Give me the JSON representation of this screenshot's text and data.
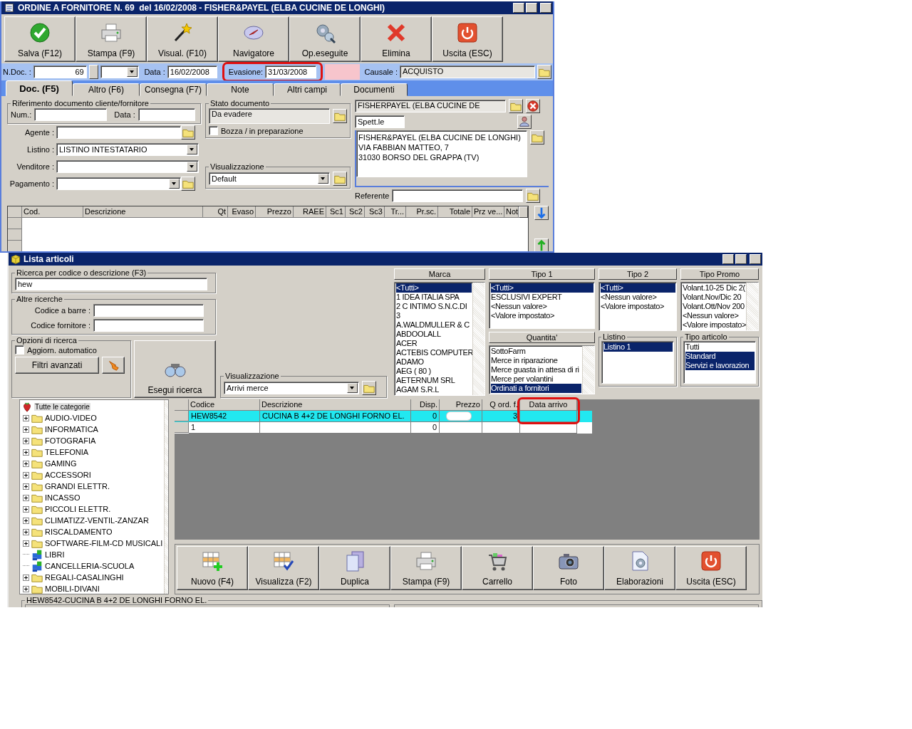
{
  "order_window": {
    "title": "ORDINE A FORNITORE N. 69  del 16/02/2008 - FISHER&PAYEL (ELBA CUCINE DE LONGHI)",
    "toolbar": [
      "Salva (F12)",
      "Stampa (F9)",
      "Visual. (F10)",
      "Navigatore",
      "Op.eseguite",
      "Elimina",
      "Uscita (ESC)"
    ],
    "header": {
      "ndoc_label": "N.Doc. :",
      "ndoc": "69",
      "data_label": "Data :",
      "data": "16/02/2008",
      "evasione_label": "Evasione:",
      "evasione": "31/03/2008",
      "evasione_highlighted": true,
      "causale_label": "Causale :",
      "causale": "ACQUISTO"
    },
    "tabs": [
      {
        "label": "Doc. (F5)",
        "selected": true
      },
      {
        "label": "Altro (F6)",
        "selected": false
      },
      {
        "label": "Consegna (F7)",
        "selected": false
      },
      {
        "label": "Note",
        "selected": false
      },
      {
        "label": "Altri campi",
        "selected": false
      },
      {
        "label": "Documenti",
        "selected": false
      }
    ],
    "riferimento": {
      "legend": "Riferimento documento cliente/fornitore",
      "num_label": "Num.:",
      "data_label": "Data :"
    },
    "left_fields": [
      {
        "label": "Agente :",
        "kind": "text"
      },
      {
        "label": "Listino :",
        "kind": "dropdown",
        "value": "LISTINO INTESTATARIO"
      },
      {
        "label": "Venditore :",
        "kind": "dropdown"
      },
      {
        "label": "Pagamento :",
        "kind": "dropdown_folder"
      }
    ],
    "stato": {
      "legend": "Stato documento",
      "value": "Da evadere",
      "bozza_label": "Bozza / in preparazione",
      "bozza_checked": false
    },
    "visualizzazione": {
      "legend": "Visualizzazione",
      "value": "Default"
    },
    "supplier": {
      "name": "FISHERPAYEL (ELBA CUCINE DE",
      "salutation": "Spett.le",
      "address": [
        "FISHER&PAYEL (ELBA CUCINE DE LONGHI)",
        "VIA FABBIAN MATTEO, 7",
        "31030 BORSO DEL GRAPPA (TV)"
      ],
      "referente_label": "Referente"
    },
    "grid": {
      "columns": [
        "Cod.",
        "Descrizione",
        "Qt",
        "Evaso",
        "Prezzo",
        "RAEE",
        "Sc1",
        "Sc2",
        "Sc3",
        "Tr...",
        "Pr.sc.",
        "Totale",
        "Prz ve...",
        "Not"
      ]
    }
  },
  "articles_window": {
    "title": "Lista articoli",
    "search": {
      "legend": "Ricerca per codice o descrizione (F3)",
      "value": "hew"
    },
    "altre": {
      "legend": "Altre ricerche",
      "barcode_label": "Codice a barre :",
      "supplier_code_label": "Codice fornitore :"
    },
    "opzioni": {
      "legend": "Opzioni di ricerca",
      "auto_label": "Aggiorn. automatico",
      "auto_checked": false,
      "filters_button": "Filtri avanzati"
    },
    "run_button": "Esegui ricerca",
    "visualizzazione": {
      "legend": "Visualizzazione",
      "value": "Arrivi merce"
    },
    "marca": {
      "header": "Marca",
      "items": [
        {
          "label": "<Tutti>",
          "selected": true
        },
        {
          "label": "1 IDEA ITALIA SPA",
          "selected": false
        },
        {
          "label": "2 C INTIMO S.N.C.DI",
          "selected": false
        },
        {
          "label": "3",
          "selected": false
        },
        {
          "label": "A.WALDMULLER & C",
          "selected": false
        },
        {
          "label": "ABDOOLALL",
          "selected": false
        },
        {
          "label": "ACER",
          "selected": false
        },
        {
          "label": "ACTEBIS COMPUTER",
          "selected": false
        },
        {
          "label": "ADAMO",
          "selected": false
        },
        {
          "label": "AEG ( 80 )",
          "selected": false
        },
        {
          "label": "AETERNUM SRL",
          "selected": false
        },
        {
          "label": "AGAM S.R.L",
          "selected": false
        }
      ]
    },
    "tipo1": {
      "header": "Tipo 1",
      "items": [
        {
          "label": "<Tutti>",
          "selected": true
        },
        {
          "label": "ESCLUSIVI EXPERT",
          "selected": false
        },
        {
          "label": "<Nessun valore>",
          "selected": false
        },
        {
          "label": "<Valore impostato>",
          "selected": false
        }
      ]
    },
    "tipo2": {
      "header": "Tipo 2",
      "items": [
        {
          "label": "<Tutti>",
          "selected": true
        },
        {
          "label": "<Nessun valore>",
          "selected": false
        },
        {
          "label": "<Valore impostato>",
          "selected": false
        }
      ]
    },
    "tipo_promo": {
      "header": "Tipo Promo",
      "items": [
        {
          "label": "Volant.10-25 Dic 2(",
          "selected": false
        },
        {
          "label": "Volant.Nov/Dic 20",
          "selected": false
        },
        {
          "label": "Volant.Ott/Nov 200",
          "selected": false
        },
        {
          "label": "<Nessun valore>",
          "selected": false
        },
        {
          "label": "<Valore impostato>",
          "selected": false
        }
      ]
    },
    "quantita": {
      "header": "Quantita'",
      "items": [
        {
          "label": "SottoFarm",
          "selected": false
        },
        {
          "label": "Merce in riparazione",
          "selected": false
        },
        {
          "label": "Merce guasta in attesa di ri",
          "selected": false
        },
        {
          "label": "Merce per volantini",
          "selected": false
        },
        {
          "label": "Ordinati a fornitori",
          "selected": true
        }
      ]
    },
    "listino": {
      "legend": "Listino",
      "items": [
        {
          "label": "Listino 1",
          "selected": true
        }
      ]
    },
    "tipo_articolo": {
      "legend": "Tipo articolo",
      "items": [
        {
          "label": "Tutti",
          "selected": false
        },
        {
          "label": "Standard",
          "selected": true
        },
        {
          "label": "Servizi e lavorazion",
          "selected": true
        }
      ]
    },
    "tree": {
      "label": "Tutte le categorie",
      "selected": true,
      "children": [
        {
          "label": "AUDIO-VIDEO",
          "expandable": true
        },
        {
          "label": "INFORMATICA",
          "expandable": true
        },
        {
          "label": "FOTOGRAFIA",
          "expandable": true
        },
        {
          "label": "TELEFONIA",
          "expandable": true
        },
        {
          "label": "GAMING",
          "expandable": true
        },
        {
          "label": "ACCESSORI",
          "expandable": true
        },
        {
          "label": "GRANDI ELETTR.",
          "expandable": true
        },
        {
          "label": "INCASSO",
          "expandable": true
        },
        {
          "label": "PICCOLI ELETTR.",
          "expandable": true
        },
        {
          "label": "CLIMATIZZ-VENTIL-ZANZAR",
          "expandable": true
        },
        {
          "label": "RISCALDAMENTO",
          "expandable": true
        },
        {
          "label": "SOFTWARE-FILM-CD MUSICALI",
          "expandable": true
        },
        {
          "label": "LIBRI",
          "expandable": false
        },
        {
          "label": "CANCELLERIA-SCUOLA",
          "expandable": false
        },
        {
          "label": "REGALI-CASALINGHI",
          "expandable": true
        },
        {
          "label": "MOBILI-DIVANI",
          "expandable": true
        }
      ]
    },
    "grid": {
      "columns": [
        {
          "label": "Codice",
          "highlighted": false
        },
        {
          "label": "Descrizione",
          "highlighted": false
        },
        {
          "label": "Disp.",
          "highlighted": false
        },
        {
          "label": "Prezzo",
          "highlighted": false
        },
        {
          "label": "Q ord. f.",
          "highlighted": false
        },
        {
          "label": "Data arrivo",
          "highlighted": true
        }
      ],
      "rows": [
        {
          "cells": [
            "HEW8542",
            "CUCINA B 4+2 DE LONGHI FORNO EL.",
            "0",
            "",
            "3",
            ""
          ],
          "selected": true,
          "price_blanked": true
        },
        {
          "cells": [
            "1",
            "",
            "0",
            "",
            "",
            ""
          ],
          "selected": false,
          "price_blanked": false
        }
      ]
    },
    "buttons": [
      "Nuovo (F4)",
      "Visualizza (F2)",
      "Duplica",
      "Stampa (F9)",
      "Carrello",
      "Foto",
      "Elaborazioni",
      "Uscita (ESC)"
    ],
    "detail_legend": "HEW8542-CUCINA B 4+2 DE LONGHI FORNO EL."
  }
}
